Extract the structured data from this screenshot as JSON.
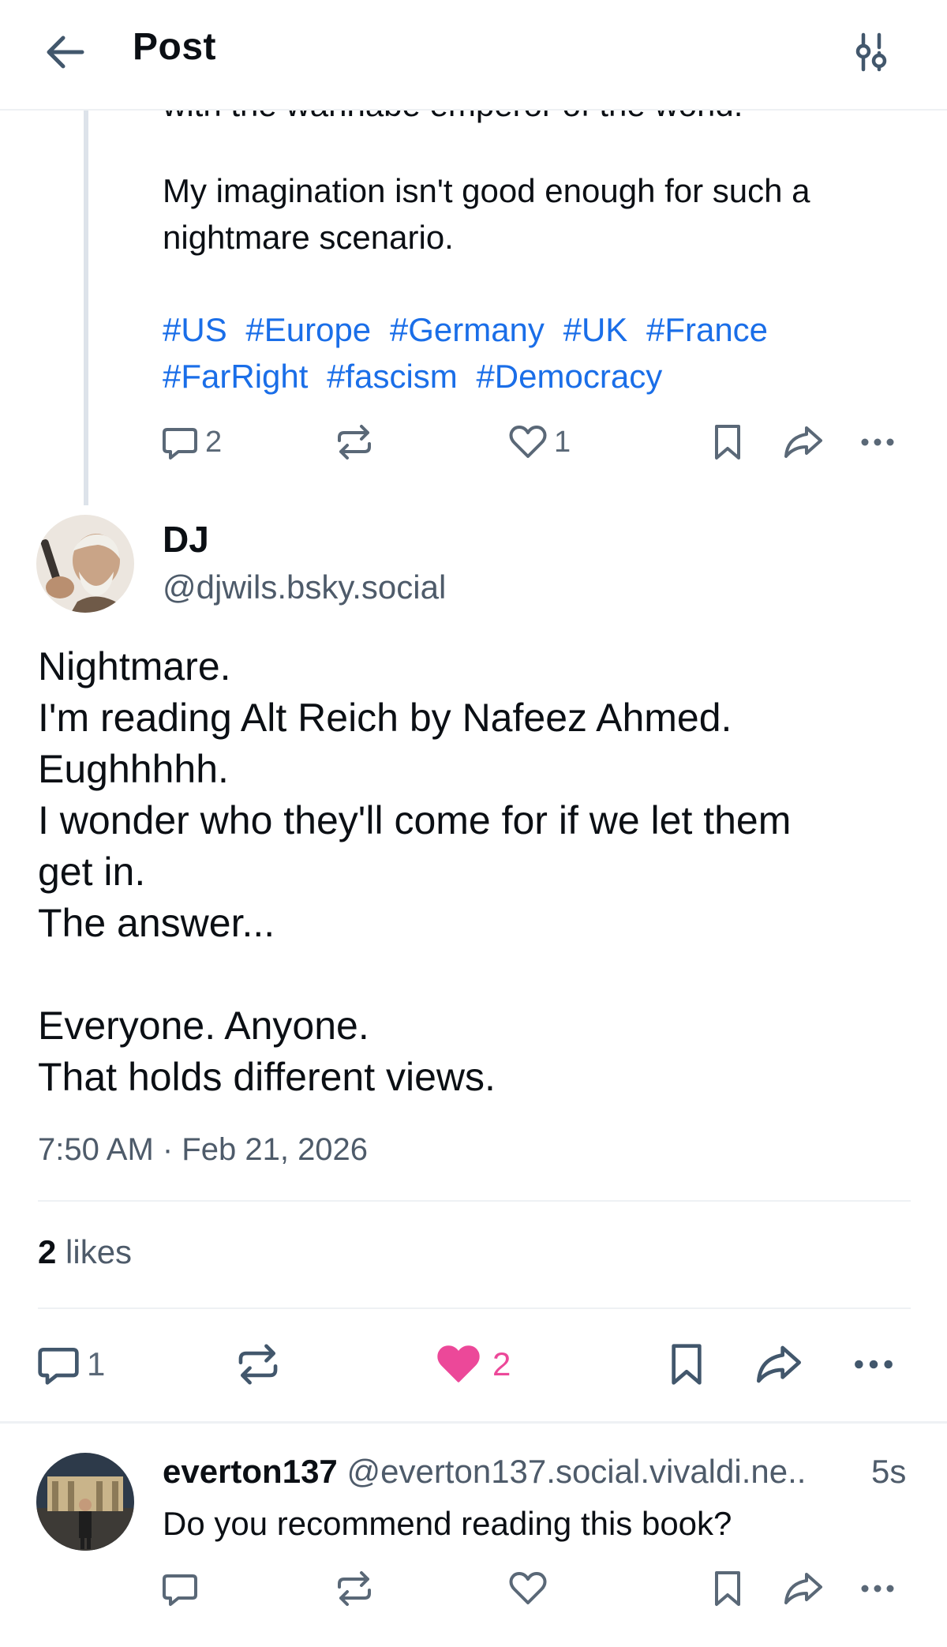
{
  "header": {
    "title": "Post",
    "back_icon": "arrow-left-icon",
    "filter_icon": "sliders-icon"
  },
  "parent_post": {
    "clipped_text": "with the wannabe emperor of the world.",
    "body": "My imagination isn't good enough for such a nightmare scenario.",
    "hashtags": [
      "#US",
      "#Europe",
      "#Germany",
      "#UK",
      "#France",
      "#FarRight",
      "#fascism",
      "#Democracy"
    ],
    "reply_count": "2",
    "like_count": "1"
  },
  "main_post": {
    "author_name": "DJ",
    "author_handle": "@djwils.bsky.social",
    "lines": [
      "Nightmare.",
      "I'm reading Alt Reich by Nafeez Ahmed.",
      "Eughhhhh.",
      "I wonder who they'll come for if we let them",
      "get in.",
      "The answer...",
      "",
      "Everyone. Anyone.",
      "That holds different views."
    ],
    "timestamp": "7:50 AM · Feb 21, 2026",
    "likes_number": "2",
    "likes_word": " likes",
    "reply_count": "1",
    "like_count": "2",
    "like_color": "#ec4899"
  },
  "reply": {
    "author_name": "everton137",
    "author_handle": "@everton137.social.vivaldi.ne..",
    "time": "5s",
    "text": "Do you recommend reading this book?"
  },
  "colors": {
    "link": "#1a6ee8",
    "muted": "#4e5b6a",
    "icon": "#5a6877"
  }
}
